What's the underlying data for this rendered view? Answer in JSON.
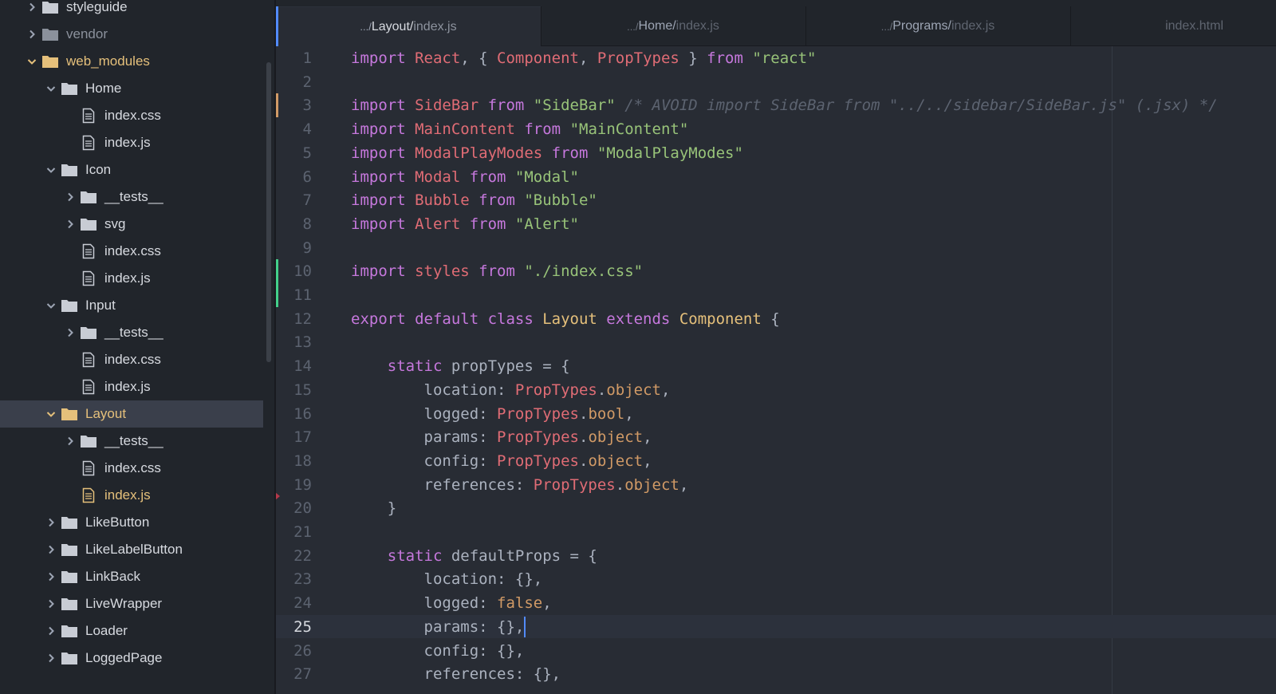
{
  "tree": {
    "rows": [
      {
        "label": "styleguide",
        "type": "folder",
        "level": 0,
        "expanded": false
      },
      {
        "label": "vendor",
        "type": "folder",
        "level": 0,
        "expanded": false,
        "dim": true
      },
      {
        "label": "web_modules",
        "type": "folder",
        "level": 0,
        "expanded": true,
        "active": true
      },
      {
        "label": "Home",
        "type": "folder",
        "level": 1,
        "expanded": true
      },
      {
        "label": "index.css",
        "type": "file",
        "level": 2
      },
      {
        "label": "index.js",
        "type": "file",
        "level": 2
      },
      {
        "label": "Icon",
        "type": "folder",
        "level": 1,
        "expanded": true
      },
      {
        "label": "__tests__",
        "type": "folder",
        "level": 2,
        "expanded": false
      },
      {
        "label": "svg",
        "type": "folder",
        "level": 2,
        "expanded": false
      },
      {
        "label": "index.css",
        "type": "file",
        "level": 2
      },
      {
        "label": "index.js",
        "type": "file",
        "level": 2
      },
      {
        "label": "Input",
        "type": "folder",
        "level": 1,
        "expanded": true
      },
      {
        "label": "__tests__",
        "type": "folder",
        "level": 2,
        "expanded": false
      },
      {
        "label": "index.css",
        "type": "file",
        "level": 2
      },
      {
        "label": "index.js",
        "type": "file",
        "level": 2
      },
      {
        "label": "Layout",
        "type": "folder",
        "level": 1,
        "expanded": true,
        "active": true,
        "selected": true
      },
      {
        "label": "__tests__",
        "type": "folder",
        "level": 2,
        "expanded": false
      },
      {
        "label": "index.css",
        "type": "file",
        "level": 2
      },
      {
        "label": "index.js",
        "type": "file",
        "level": 2,
        "active": true
      },
      {
        "label": "LikeButton",
        "type": "folder",
        "level": 1,
        "expanded": false
      },
      {
        "label": "LikeLabelButton",
        "type": "folder",
        "level": 1,
        "expanded": false
      },
      {
        "label": "LinkBack",
        "type": "folder",
        "level": 1,
        "expanded": false
      },
      {
        "label": "LiveWrapper",
        "type": "folder",
        "level": 1,
        "expanded": false
      },
      {
        "label": "Loader",
        "type": "folder",
        "level": 1,
        "expanded": false
      },
      {
        "label": "LoggedPage",
        "type": "folder",
        "level": 1,
        "expanded": false
      }
    ]
  },
  "tabs": [
    {
      "prefix": ".../",
      "dir": "Layout/",
      "file": "index.js",
      "active": true
    },
    {
      "prefix": ".../",
      "dir": "Home/",
      "file": "index.js",
      "active": false
    },
    {
      "prefix": ".../",
      "dir": "Programs/",
      "file": "index.js",
      "active": false
    },
    {
      "prefix": "",
      "dir": "",
      "file": "index.html",
      "active": false
    }
  ],
  "editor": {
    "cursor_line": 25,
    "lines": [
      {
        "n": "1",
        "tokens": [
          [
            "kw",
            "import "
          ],
          [
            "var",
            "React"
          ],
          [
            "pl",
            ", { "
          ],
          [
            "var",
            "Component"
          ],
          [
            "pl",
            ", "
          ],
          [
            "var",
            "PropTypes"
          ],
          [
            "pl",
            " } "
          ],
          [
            "kw",
            "from "
          ],
          [
            "str",
            "\"react\""
          ]
        ]
      },
      {
        "n": "2",
        "tokens": []
      },
      {
        "n": "3",
        "tokens": [
          [
            "kw",
            "import "
          ],
          [
            "var",
            "SideBar "
          ],
          [
            "kw",
            "from "
          ],
          [
            "str",
            "\"SideBar\" "
          ],
          [
            "com",
            "/* AVOID import SideBar from \"../../sidebar/SideBar.js\" (.jsx) */"
          ]
        ]
      },
      {
        "n": "4",
        "tokens": [
          [
            "kw",
            "import "
          ],
          [
            "var",
            "MainContent "
          ],
          [
            "kw",
            "from "
          ],
          [
            "str",
            "\"MainContent\""
          ]
        ]
      },
      {
        "n": "5",
        "tokens": [
          [
            "kw",
            "import "
          ],
          [
            "var",
            "ModalPlayModes "
          ],
          [
            "kw",
            "from "
          ],
          [
            "str",
            "\"ModalPlayModes\""
          ]
        ]
      },
      {
        "n": "6",
        "tokens": [
          [
            "kw",
            "import "
          ],
          [
            "var",
            "Modal "
          ],
          [
            "kw",
            "from "
          ],
          [
            "str",
            "\"Modal\""
          ]
        ]
      },
      {
        "n": "7",
        "tokens": [
          [
            "kw",
            "import "
          ],
          [
            "var",
            "Bubble "
          ],
          [
            "kw",
            "from "
          ],
          [
            "str",
            "\"Bubble\""
          ]
        ]
      },
      {
        "n": "8",
        "tokens": [
          [
            "kw",
            "import "
          ],
          [
            "var",
            "Alert "
          ],
          [
            "kw",
            "from "
          ],
          [
            "str",
            "\"Alert\""
          ]
        ]
      },
      {
        "n": "9",
        "tokens": []
      },
      {
        "n": "10",
        "tokens": [
          [
            "kw",
            "import "
          ],
          [
            "var",
            "styles "
          ],
          [
            "kw",
            "from "
          ],
          [
            "str",
            "\"./index.css\""
          ]
        ]
      },
      {
        "n": "11",
        "tokens": []
      },
      {
        "n": "12",
        "tokens": [
          [
            "kw",
            "export default class "
          ],
          [
            "cls",
            "Layout "
          ],
          [
            "kw",
            "extends "
          ],
          [
            "cls",
            "Component "
          ],
          [
            "pl",
            "{"
          ]
        ]
      },
      {
        "n": "13",
        "tokens": []
      },
      {
        "n": "14",
        "tokens": [
          [
            "pl",
            "    "
          ],
          [
            "kw",
            "static "
          ],
          [
            "pl",
            "propTypes = {"
          ]
        ]
      },
      {
        "n": "15",
        "tokens": [
          [
            "pl",
            "        location: "
          ],
          [
            "var",
            "PropTypes"
          ],
          [
            "pl",
            "."
          ],
          [
            "prop",
            "object"
          ],
          [
            "pl",
            ","
          ]
        ]
      },
      {
        "n": "16",
        "tokens": [
          [
            "pl",
            "        logged: "
          ],
          [
            "var",
            "PropTypes"
          ],
          [
            "pl",
            "."
          ],
          [
            "prop",
            "bool"
          ],
          [
            "pl",
            ","
          ]
        ]
      },
      {
        "n": "17",
        "tokens": [
          [
            "pl",
            "        params: "
          ],
          [
            "var",
            "PropTypes"
          ],
          [
            "pl",
            "."
          ],
          [
            "prop",
            "object"
          ],
          [
            "pl",
            ","
          ]
        ]
      },
      {
        "n": "18",
        "tokens": [
          [
            "pl",
            "        config: "
          ],
          [
            "var",
            "PropTypes"
          ],
          [
            "pl",
            "."
          ],
          [
            "prop",
            "object"
          ],
          [
            "pl",
            ","
          ]
        ]
      },
      {
        "n": "19",
        "tokens": [
          [
            "pl",
            "        references: "
          ],
          [
            "var",
            "PropTypes"
          ],
          [
            "pl",
            "."
          ],
          [
            "prop",
            "object"
          ],
          [
            "pl",
            ","
          ]
        ]
      },
      {
        "n": "20",
        "tokens": [
          [
            "pl",
            "    }"
          ]
        ]
      },
      {
        "n": "21",
        "tokens": []
      },
      {
        "n": "22",
        "tokens": [
          [
            "pl",
            "    "
          ],
          [
            "kw",
            "static "
          ],
          [
            "pl",
            "defaultProps = {"
          ]
        ]
      },
      {
        "n": "23",
        "tokens": [
          [
            "pl",
            "        location: {},"
          ]
        ]
      },
      {
        "n": "24",
        "tokens": [
          [
            "pl",
            "        logged: "
          ],
          [
            "prop",
            "false"
          ],
          [
            "pl",
            ","
          ]
        ]
      },
      {
        "n": "25",
        "tokens": [
          [
            "pl",
            "        params: {},"
          ]
        ]
      },
      {
        "n": "26",
        "tokens": [
          [
            "pl",
            "        config: {},"
          ]
        ]
      },
      {
        "n": "27",
        "tokens": [
          [
            "pl",
            "        references: {},"
          ]
        ]
      }
    ]
  }
}
